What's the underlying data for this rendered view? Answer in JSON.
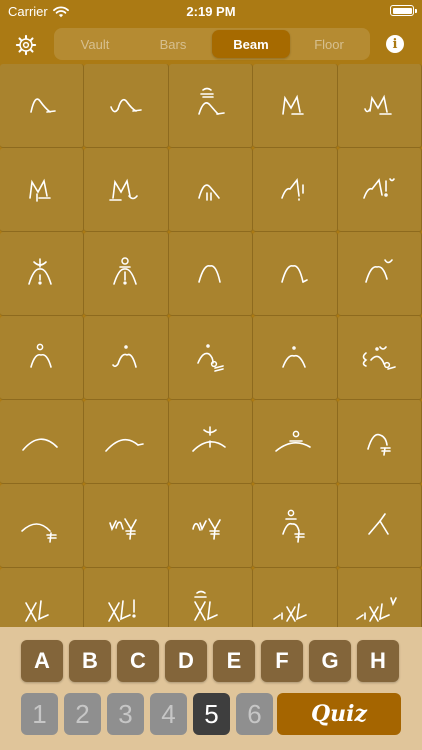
{
  "status": {
    "carrier": "Carrier",
    "time": "2:19 PM",
    "icons": [
      "wifi-icon",
      "battery-icon"
    ]
  },
  "nav": {
    "settings_icon": "gear-icon",
    "info_icon": "info-icon",
    "info_glyph": "i",
    "tabs": [
      {
        "label": "Vault",
        "selected": false
      },
      {
        "label": "Bars",
        "selected": false
      },
      {
        "label": "Beam",
        "selected": true
      },
      {
        "label": "Floor",
        "selected": false
      }
    ]
  },
  "grid": {
    "columns": 5,
    "cell_count": 35,
    "glyph_style": "white handwritten script marks"
  },
  "keyboard": {
    "letters": [
      "A",
      "B",
      "C",
      "D",
      "E",
      "F",
      "G",
      "H"
    ],
    "numbers": [
      {
        "label": "1",
        "active": false
      },
      {
        "label": "2",
        "active": false
      },
      {
        "label": "3",
        "active": false
      },
      {
        "label": "4",
        "active": false
      },
      {
        "label": "5",
        "active": true
      },
      {
        "label": "6",
        "active": false
      }
    ],
    "quiz_label": "Quiz"
  },
  "colors": {
    "background": "#ab7a14",
    "cell": "#a9832e",
    "selected_tab": "#a66a00",
    "keyboard_bg": "#e0c59a",
    "key": "#83653a",
    "quiz": "#a56500",
    "inactive_number": "#8f8f8f",
    "active_number": "#3e3e3e"
  }
}
